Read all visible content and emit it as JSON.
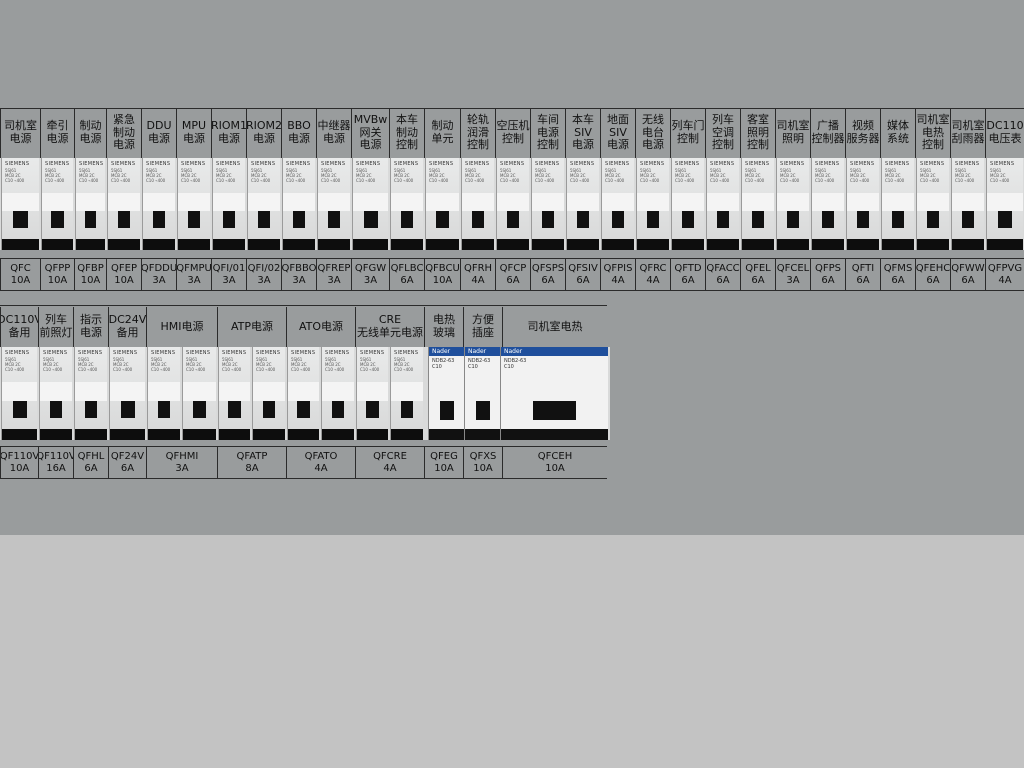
{
  "row1": {
    "labels": [
      "司机室\n电源",
      "牵引\n电源",
      "制动\n电源",
      "紧急\n制动\n电源",
      "DDU\n电源",
      "MPU\n电源",
      "RIOM1\n电源",
      "RIOM2\n电源",
      "BBO\n电源",
      "中继器\n电源",
      "MVBw\n网关\n电源",
      "本车\n制动\n控制",
      "制动\n单元",
      "轮轨\n润滑\n控制",
      "空压机\n控制",
      "车间\n电源\n控制",
      "本车\nSIV\n电源",
      "地面\nSIV\n电源",
      "无线\n电台\n电源",
      "列车门\n控制",
      "列车\n空调\n控制",
      "客室\n照明\n控制",
      "司机室\n照明",
      "广播\n控制器",
      "视频\n服务器",
      "媒体\n系统",
      "司机室\n电热\n控制",
      "司机室\n刮雨器",
      "DC110\n电压表"
    ],
    "ratings": [
      "QFC\n10A",
      "QFPP\n10A",
      "QFBP\n10A",
      "QFEP\n10A",
      "QFDDU\n3A",
      "QFMPU\n3A",
      "QFI/01\n3A",
      "QFI/02\n3A",
      "QFBBO\n3A",
      "QFREP\n3A",
      "QFGW\n3A",
      "QFLBC\n6A",
      "QFBCU\n10A",
      "QFRH\n4A",
      "QFCP\n6A",
      "QFSPS\n6A",
      "QFSIV\n6A",
      "QFPIS\n4A",
      "QFRC\n4A",
      "QFTD\n6A",
      "QFACC\n6A",
      "QFEL\n6A",
      "QFCEL\n3A",
      "QFPS\n6A",
      "QFTI\n6A",
      "QFMS\n6A",
      "QFEHC\n6A",
      "QFWW\n6A",
      "QFPVG\n4A"
    ]
  },
  "row2": {
    "labels": [
      "DC110V\n备用",
      "列车\n前照灯",
      "指示\n电源",
      "DC24V\n备用",
      "HMI电源",
      "ATP电源",
      "ATO电源",
      "CRE\n无线单元电源",
      "电热\n玻璃",
      "方便\n插座",
      "司机室电热"
    ],
    "ratings": [
      "QF110V\n10A",
      "QF110V\n16A",
      "QFHL\n6A",
      "QF24V\n6A",
      "QFHMI\n3A",
      "QFATP\n8A",
      "QFATO\n4A",
      "QFCRE\n4A",
      "QFEG\n10A",
      "QFXS\n10A",
      "QFCEH\n10A"
    ]
  },
  "breaker": {
    "siemens_brand": "SIEMENS",
    "siemens_spec": "5SJ61\nMCB 2C\nC10 ⌁400",
    "nader_brand": "Nader",
    "nader_spec": "NDB2-63\nC10"
  }
}
